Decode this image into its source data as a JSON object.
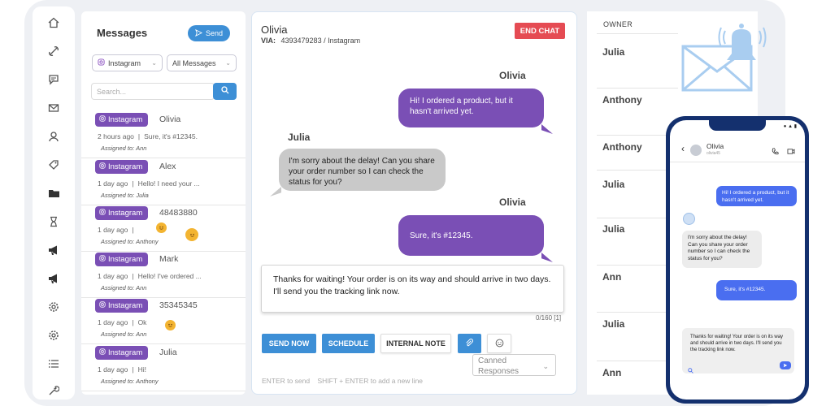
{
  "messages_panel": {
    "title": "Messages",
    "send_label": "Send",
    "channel_filter": "Instagram",
    "type_filter": "All Messages",
    "search_placeholder": "Search..."
  },
  "conversations": [
    {
      "channel": "Instagram",
      "name": "Olivia",
      "time": "2 hours ago",
      "sep": "|",
      "preview": "Sure, it's #12345.",
      "assigned": "Assigned to: Ann"
    },
    {
      "channel": "Instagram",
      "name": "Alex",
      "time": "1 day ago",
      "sep": "|",
      "preview": "Hello! I need your ...",
      "assigned": "Assigned to: Julia"
    },
    {
      "channel": "Instagram",
      "name": "48483880",
      "time": "1 day ago",
      "sep": "|",
      "preview": "",
      "assigned": "Assigned to: Anthony"
    },
    {
      "channel": "Instagram",
      "name": "Mark",
      "time": "1 day ago",
      "sep": "|",
      "preview": "Hello! I've ordered ...",
      "assigned": "Assigned to: Ann"
    },
    {
      "channel": "Instagram",
      "name": "35345345",
      "time": "1 day ago",
      "sep": "|",
      "preview": "Ok",
      "assigned": "Assigned to: Ann"
    },
    {
      "channel": "Instagram",
      "name": "Julia",
      "time": "1 day ago",
      "sep": "|",
      "preview": "Hi!",
      "assigned": "Assigned to: Anthony"
    }
  ],
  "chat": {
    "contact": "Olivia",
    "via_label": "VIA:",
    "via_value": "4393479283 / Instagram",
    "end_label": "END CHAT",
    "messages": [
      {
        "speaker": "Olivia",
        "text": "Hi! I ordered a product, but it hasn't arrived yet."
      },
      {
        "speaker": "Julia",
        "text": "I'm sorry about the delay! Can you share your order number so I can check the status for you?"
      },
      {
        "speaker": "Olivia",
        "text": "Sure, it's #12345."
      }
    ],
    "draft": "Thanks for waiting! Your order is on its way and should arrive in two days. I'll send you the tracking link now.",
    "counter": "0/160 [1]",
    "send_now": "SEND NOW",
    "schedule": "SCHEDULE",
    "internal_note": "INTERNAL NOTE",
    "canned": "Canned Responses",
    "hint": "ENTER to send    SHIFT + ENTER to add a new line"
  },
  "owner": {
    "header": "OWNER",
    "names": [
      "Julia",
      "Anthony",
      "Anthony",
      "Julia",
      "Julia",
      "Ann",
      "Julia",
      "Ann"
    ]
  },
  "phone": {
    "contact": "Olivia",
    "handle": "olivia45",
    "messages": [
      "Hi! I ordered a product, but it hasn't arrived yet.",
      "I'm sorry about the delay! Can you share your order number so I can check the status for you?",
      "Sure, it's #12345."
    ],
    "draft": "Thanks for waiting! Your order is on its way and should arrive in two days. I'll send you the tracking link now."
  },
  "colors": {
    "accent": "#3d8fd6",
    "instagram_pill": "#7a4fb5",
    "end_chat": "#e54b53",
    "phone_frame": "#14306e"
  }
}
